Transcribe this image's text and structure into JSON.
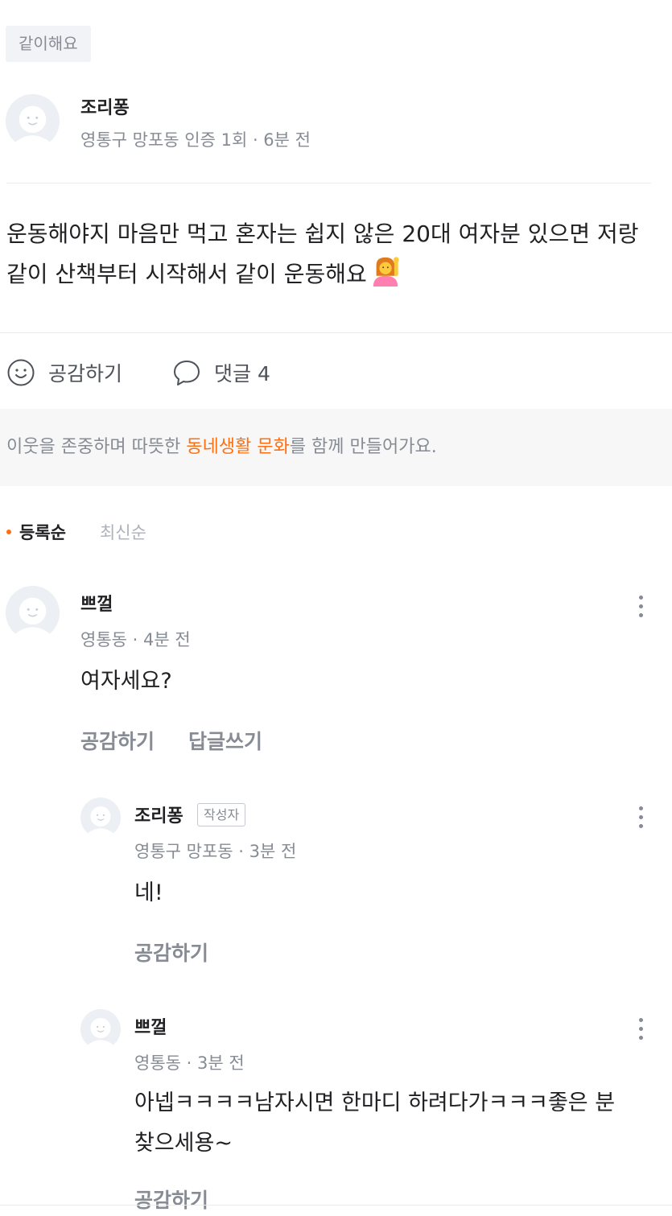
{
  "post": {
    "category": "같이해요",
    "author": {
      "name": "조리퐁",
      "meta": "영통구 망포동 인증 1회 · 6분 전"
    },
    "body": "운동해야지 마음만 먹고 혼자는 쉽지 않은 20대 여자분 있으면 저랑 같이 산책부터 시작해서 같이 운동해요"
  },
  "actions": {
    "like_label": "공감하기",
    "comment_label": "댓글 4"
  },
  "notice": {
    "prefix": "이웃을 존중하며 따뜻한 ",
    "highlight": "동네생활 문화",
    "suffix": "를 함께 만들어가요."
  },
  "sort": {
    "active": "등록순",
    "inactive": "최신순"
  },
  "comments": [
    {
      "name": "쁘껄",
      "meta": "영통동 · 4분 전",
      "text": "여자세요?",
      "like_label": "공감하기",
      "reply_label": "답글쓰기"
    },
    {
      "name": "조리퐁",
      "badge": "작성자",
      "meta": "영통구 망포동 · 3분 전",
      "text": "네!",
      "like_label": "공감하기"
    },
    {
      "name": "쁘껄",
      "meta": "영통동 · 3분 전",
      "text": "아넵ㅋㅋㅋㅋ남자시면 한마디 하려다가ㅋㅋㅋ좋은 분 찾으세용~",
      "like_label": "공감하기"
    }
  ],
  "colors": {
    "accent": "#ff6f0f",
    "muted": "#868b94",
    "text": "#212124"
  },
  "icons": {
    "avatar": "default-profile-icon",
    "like": "smile-icon",
    "comment": "speech-bubble-icon",
    "more": "more-vertical-icon",
    "emoji": "person-raising-hand-emoji"
  }
}
